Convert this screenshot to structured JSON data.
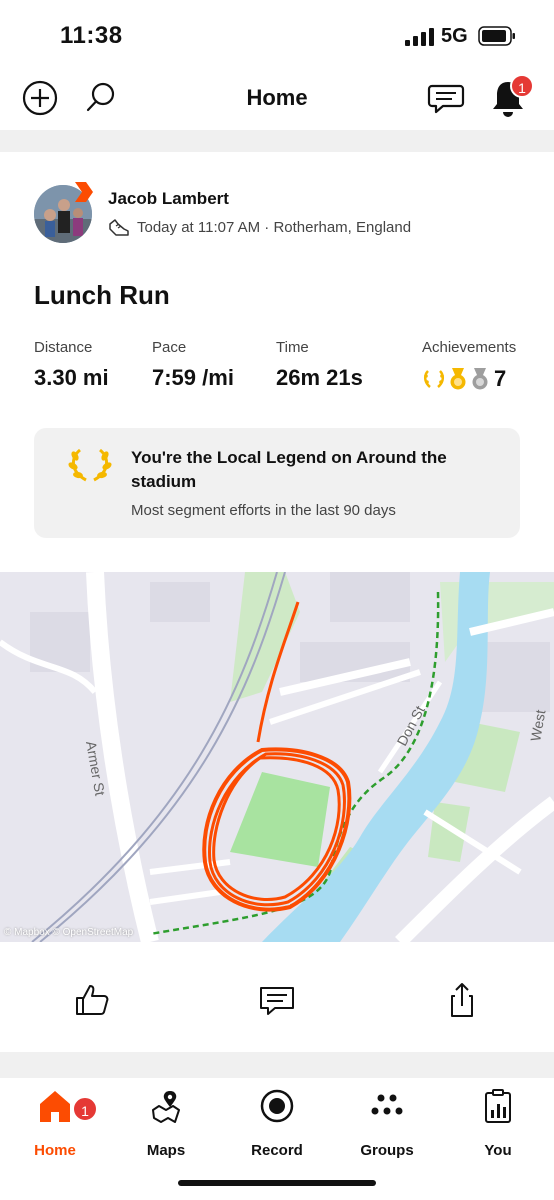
{
  "status_bar": {
    "time": "11:38",
    "network": "5G"
  },
  "top_nav": {
    "title": "Home",
    "notification_count": "1"
  },
  "activity": {
    "athlete_name": "Jacob Lambert",
    "meta": "Today at 11:07 AM · Rotherham, England",
    "title": "Lunch Run",
    "stats": [
      {
        "label": "Distance",
        "value": "3.30 mi"
      },
      {
        "label": "Pace",
        "value": "7:59 /mi"
      },
      {
        "label": "Time",
        "value": "26m 21s"
      }
    ],
    "achievements": {
      "label": "Achievements",
      "count": "7"
    },
    "legend": {
      "title": "You're the Local Legend on Around the stadium",
      "subtitle": "Most segment efforts in the last 90 days"
    }
  },
  "map": {
    "labels": {
      "street_armer": "Armer St",
      "street_don": "Don St",
      "street_west": "West"
    },
    "attribution": "© Mapbox © OpenStreetMap",
    "colors": {
      "route": "#fc4c02",
      "water": "#a7dcf2",
      "park": "#bfe8b8",
      "pitch": "#a8e3a0"
    }
  },
  "tabs": [
    {
      "label": "Home",
      "badge": "1",
      "active": true
    },
    {
      "label": "Maps"
    },
    {
      "label": "Record"
    },
    {
      "label": "Groups"
    },
    {
      "label": "You"
    }
  ],
  "colors": {
    "accent": "#fc4c02",
    "badge": "#e53935"
  }
}
